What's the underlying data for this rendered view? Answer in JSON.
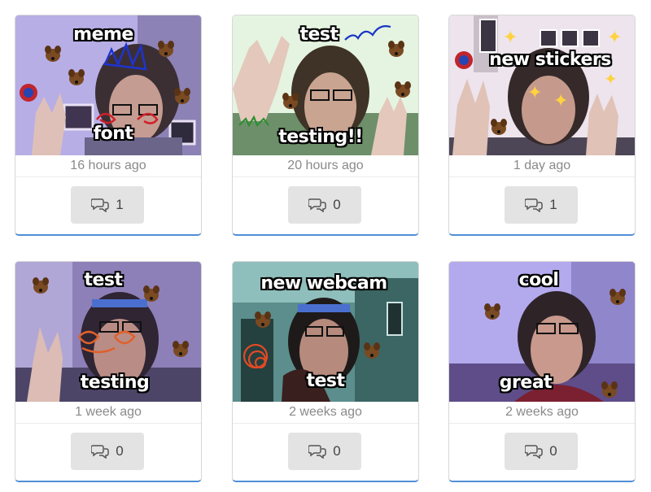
{
  "posts": [
    {
      "captions": [
        "meme",
        "font"
      ],
      "time": "16 hours ago",
      "comments": "1",
      "palette": [
        "#b9aee8",
        "#6c5f8d",
        "#3c3347"
      ]
    },
    {
      "captions": [
        "test",
        "testing!!"
      ],
      "time": "20 hours ago",
      "comments": "0",
      "palette": [
        "#e6f6e2",
        "#86a57f",
        "#3d4a3a"
      ]
    },
    {
      "captions": [
        "new stickers"
      ],
      "time": "1 day ago",
      "comments": "1",
      "palette": [
        "#efe6ef",
        "#a29aa5",
        "#4a4150"
      ]
    },
    {
      "captions": [
        "test",
        "testing"
      ],
      "time": "1 week ago",
      "comments": "0",
      "palette": [
        "#8e7fb8",
        "#5f5581",
        "#322b45"
      ]
    },
    {
      "captions": [
        "new webcam",
        "test"
      ],
      "time": "2 weeks ago",
      "comments": "0",
      "palette": [
        "#5b8f8d",
        "#2f5856",
        "#1c302f"
      ]
    },
    {
      "captions": [
        "cool",
        "great"
      ],
      "time": "2 weeks ago",
      "comments": "0",
      "palette": [
        "#b2a8ee",
        "#7f76ba",
        "#3b345c"
      ]
    }
  ],
  "icons": {
    "comment": "speech-bubbles-icon",
    "sticker": "dog-sticker-icon"
  }
}
